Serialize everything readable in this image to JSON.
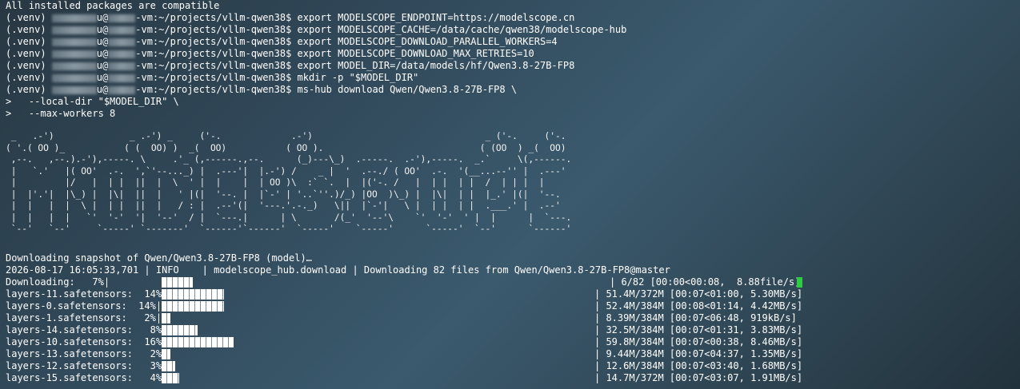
{
  "header_line": "All installed packages are compatible",
  "prompt": {
    "venv": "(.venv)",
    "host_suffix": "-vm:~/projects/vllm-qwen38$"
  },
  "commands": [
    "export MODELSCOPE_ENDPOINT=https://modelscope.cn",
    "export MODELSCOPE_CACHE=/data/cache/qwen38/modelscope-hub",
    "export MODELSCOPE_DOWNLOAD_PARALLEL_WORKERS=4",
    "export MODELSCOPE_DOWNLOAD_MAX_RETRIES=10",
    "export MODEL_DIR=/data/models/hf/Qwen3.8-27B-FP8",
    "mkdir -p \"$MODEL_DIR\"",
    "ms-hub download Qwen/Qwen3.8-27B-FP8 \\"
  ],
  "continuations": [
    ">   --local-dir \"$MODEL_DIR\" \\",
    ">   --max-workers 8"
  ],
  "ascii_banner": " _   .-')              _ .-') _     ('-.             .-')                                _ ('-.     ('-.\n( '.( OO )_           ( (  OO) )  _(  OO)           ( OO ).                             ( (OO  ) _(  OO)\n ,--.   ,--.).-'),-----. \\     .'_ (,------.,--.      (_)---\\_)  .-----.  .-'),-----.  _.`     \\(,------.\n |   `.'   |( OO'  .-.  ',`'--..._) |  .---'|  |.-') /    _ |  '  .--./ ( OO'  .-.  '(__...--'' |  .---'\n |         |/   |  | |  ||  |  \\  ' |  |    |  | OO )\\  :` `.  |  |('-. /   |  | |  | |  /  | | |  |\n |  |'.'|  |\\_) |  |\\|  ||  |   ' |(|  '--. |  |`-' | '..`''.)/_) |OO  )\\_) |  |\\|  | |  |_.' |(|  '--.\n |  |   |  |  \\ |  | |  ||  |   / : |  .--'(|  '---.'.-._)   \\||  |`-'|   \\ |  | |  | |  .___.' |  .--'\n |  |   |  |   `'  '-'  '|  '--'  / |  `---.|      | \\       /(_'  '--'\\    `'  '-'  ' |  |      |  `---.\n `--'   `--'     `-----' `-------'  `------'`------'  `-----'    `-----'      `-----'  `--'      `------'",
  "download": {
    "snapshot_line": "Downloading snapshot of Qwen/Qwen3.8-27B-FP8 (model)…",
    "log_line": "2026-08-17 16:05:33,701 | INFO    | modelscope_hub.download | Downloading 82 files from Qwen/Qwen3.8-27B-FP8@master",
    "overall": {
      "label": "Downloading:   7%|",
      "progress": 0.07,
      "stats": "| 6/82 [00:00<00:08,  8.88file/s]"
    },
    "files": [
      {
        "label": "layers-11.safetensors:  14%|",
        "progress": 0.14,
        "stats": "| 51.4M/372M [00:07<01:00, 5.30MB/s]"
      },
      {
        "label": "layers-0.safetensors:  14%|",
        "progress": 0.14,
        "stats": "| 52.4M/384M [00:08<01:14, 4.42MB/s]"
      },
      {
        "label": "layers-1.safetensors:   2%|",
        "progress": 0.02,
        "stats": "| 8.39M/384M [00:07<06:48, 919kB/s]"
      },
      {
        "label": "layers-14.safetensors:   8%|",
        "progress": 0.08,
        "stats": "| 32.5M/384M [00:07<01:31, 3.83MB/s]"
      },
      {
        "label": "layers-10.safetensors:  16%|",
        "progress": 0.16,
        "stats": "| 59.8M/384M [00:07<00:38, 8.46MB/s]"
      },
      {
        "label": "layers-13.safetensors:   2%|",
        "progress": 0.02,
        "stats": "| 9.44M/384M [00:07<04:37, 1.35MB/s]"
      },
      {
        "label": "layers-12.safetensors:   3%|",
        "progress": 0.03,
        "stats": "| 12.6M/384M [00:07<03:40, 1.68MB/s]"
      },
      {
        "label": "layers-15.safetensors:   4%|",
        "progress": 0.04,
        "stats": "| 14.7M/372M [00:07<03:07, 1.91MB/s]"
      }
    ]
  },
  "colors": {
    "cursor": "#2ecc40",
    "text": "#ffffff"
  }
}
